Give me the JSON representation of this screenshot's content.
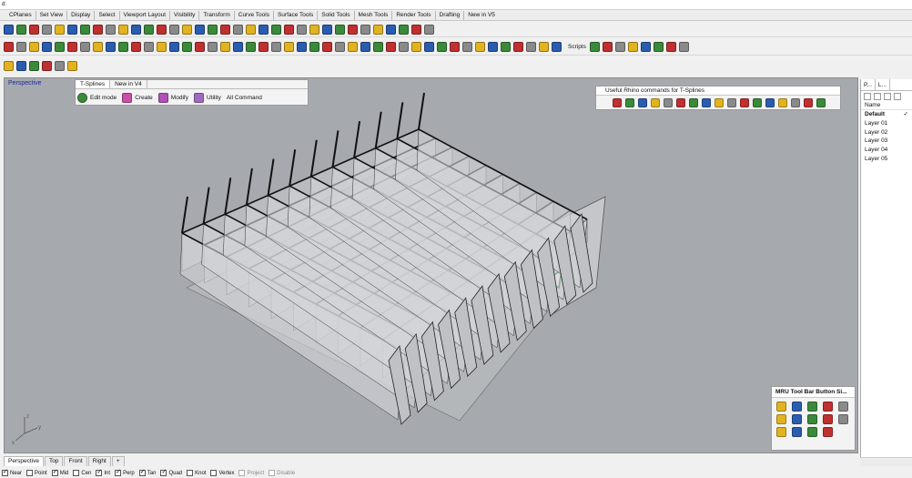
{
  "command_line": {
    "text": "d:"
  },
  "toolbar_tabs": [
    "CPlanes",
    "Set View",
    "Display",
    "Select",
    "Viewport Layout",
    "Visibility",
    "Transform",
    "Curve Tools",
    "Surface Tools",
    "Solid Tools",
    "Mesh Tools",
    "Render Tools",
    "Drafting",
    "New in V5"
  ],
  "row2_label": "Scripts",
  "viewport": {
    "title": "Perspective"
  },
  "tsplines_panel": {
    "tabs": [
      "T-Splines",
      "New in V4"
    ],
    "tools": [
      "Edit mode",
      "Create",
      "Modify",
      "Utility",
      "All Command"
    ]
  },
  "useful_panel": {
    "title": "Useful Rhino commands for T-Splines"
  },
  "mru_panel": {
    "title": "MRU Tool Bar Button Si..."
  },
  "layers_panel": {
    "tabs": [
      "P...",
      "L..."
    ],
    "header": "Name",
    "items": [
      {
        "label": "Default",
        "check": "✓"
      },
      {
        "label": "Layer 01",
        "check": ""
      },
      {
        "label": "Layer 02",
        "check": ""
      },
      {
        "label": "Layer 03",
        "check": ""
      },
      {
        "label": "Layer 04",
        "check": ""
      },
      {
        "label": "Layer 05",
        "check": ""
      }
    ]
  },
  "viewport_tabs": [
    "Perspective",
    "Top",
    "Front",
    "Right",
    "+"
  ],
  "osnaps": [
    {
      "label": "Near",
      "state": "on"
    },
    {
      "label": "Point",
      "state": "off"
    },
    {
      "label": "Mid",
      "state": "on"
    },
    {
      "label": "Cen",
      "state": "off"
    },
    {
      "label": "Int",
      "state": "on"
    },
    {
      "label": "Perp",
      "state": "on"
    },
    {
      "label": "Tan",
      "state": "on"
    },
    {
      "label": "Quad",
      "state": "on"
    },
    {
      "label": "Knot",
      "state": "off"
    },
    {
      "label": "Vertex",
      "state": "off"
    },
    {
      "label": "Project",
      "state": "disabled"
    },
    {
      "label": "Disable",
      "state": "disabled"
    }
  ],
  "icon_colors": {
    "blue": "#2a5db0",
    "red": "#c03030",
    "yellow": "#e2b320",
    "green": "#3a8a3a",
    "gray": "#8a8a8a"
  }
}
